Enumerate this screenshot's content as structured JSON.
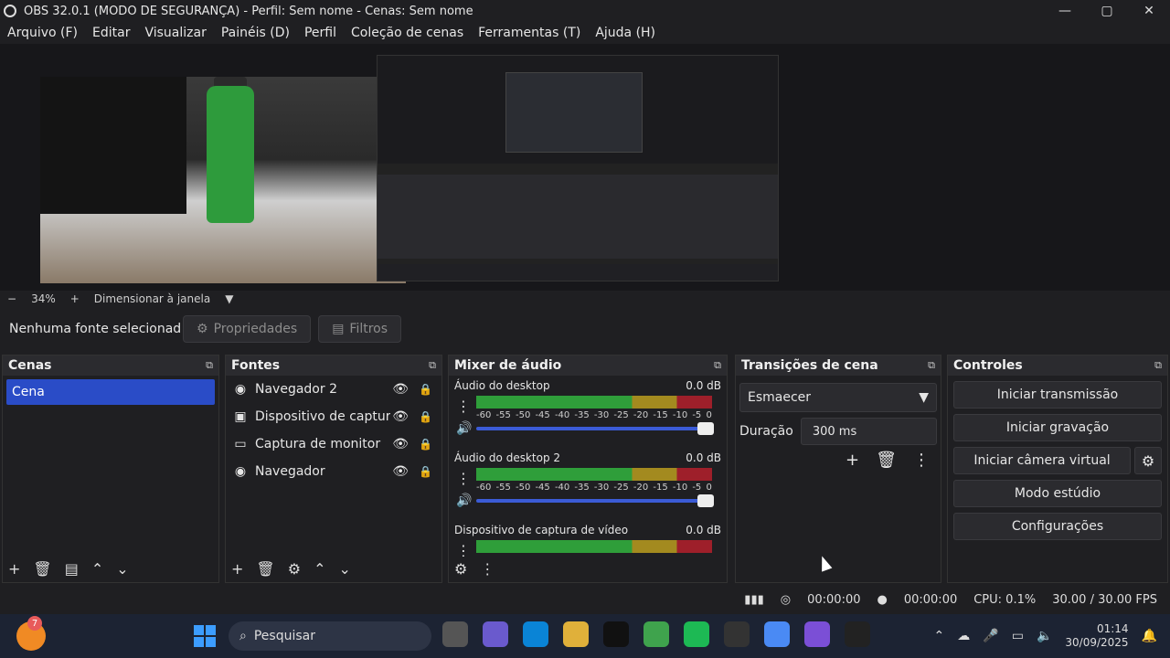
{
  "window": {
    "title": "OBS 32.0.1 (MODO DE SEGURANÇA) - Perfil: Sem nome - Cenas: Sem nome",
    "minimize": "—",
    "maximize": "▢",
    "close": "✕"
  },
  "menu": {
    "items": [
      "Arquivo (F)",
      "Editar",
      "Visualizar",
      "Painéis (D)",
      "Perfil",
      "Coleção de cenas",
      "Ferramentas (T)",
      "Ajuda (H)"
    ]
  },
  "zoom": {
    "minus": "−",
    "value": "34%",
    "plus": "+",
    "mode": "Dimensionar à janela",
    "caret": "▼"
  },
  "sourcebar": {
    "no_source": "Nenhuma fonte selecionad",
    "properties": "Propriedades",
    "filters": "Filtros"
  },
  "panels": {
    "cenas": {
      "title": "Cenas",
      "items": [
        "Cena"
      ]
    },
    "fontes": {
      "title": "Fontes",
      "items": [
        {
          "name": "Navegador 2",
          "icon": "globe-icon"
        },
        {
          "name": "Dispositivo de captura de vídeo",
          "icon": "camera-icon"
        },
        {
          "name": "Captura de monitor",
          "icon": "monitor-icon"
        },
        {
          "name": "Navegador",
          "icon": "globe-icon"
        }
      ]
    },
    "mixer": {
      "title": "Mixer de áudio",
      "channels": [
        {
          "name": "Áudio do desktop",
          "level": "0.0 dB"
        },
        {
          "name": "Áudio do desktop 2",
          "level": "0.0 dB"
        },
        {
          "name": "Dispositivo de captura de vídeo",
          "level": "0.0 dB"
        }
      ],
      "ticks": [
        "-60",
        "-55",
        "-50",
        "-45",
        "-40",
        "-35",
        "-30",
        "-25",
        "-20",
        "-15",
        "-10",
        "-5",
        "0"
      ]
    },
    "transicoes": {
      "title": "Transições de cena",
      "selected": "Esmaecer",
      "duration_label": "Duração",
      "duration_value": "300 ms"
    },
    "controles": {
      "title": "Controles",
      "start_stream": "Iniciar transmissão",
      "start_record": "Iniciar gravação",
      "start_vcam": "Iniciar câmera virtual",
      "studio_mode": "Modo estúdio",
      "settings": "Configurações"
    }
  },
  "status": {
    "stream_time": "00:00:00",
    "record_time": "00:00:00",
    "cpu": "CPU: 0.1%",
    "fps": "30.00 / 30.00 FPS"
  },
  "taskbar": {
    "badge": "7",
    "search": "Pesquisar",
    "time": "01:14",
    "date": "30/09/2025"
  },
  "colors": {
    "accent": "#2a4cc7",
    "meter_green": "#2f9e3a",
    "meter_yellow": "#a38a1f",
    "meter_red": "#9e1f2a"
  }
}
